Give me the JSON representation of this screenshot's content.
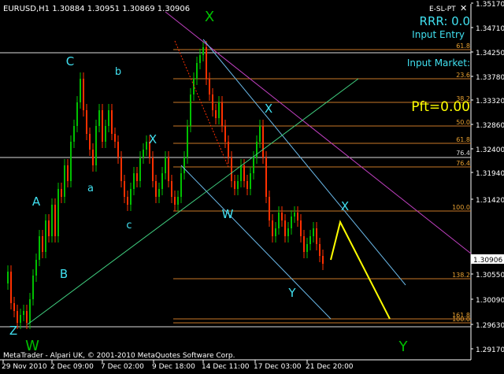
{
  "header": {
    "symbol_info": "EURUSD,H1  1.30884 1.30951 1.30869 1.30906",
    "indicator": "E-SL-PT"
  },
  "footer": {
    "copyright": "MetaTrader - Alpari UK, © 2001-2010 MetaQuotes Software Corp."
  },
  "panel": {
    "rrr": "RRR: 0.0",
    "input_entry": "Input Entry",
    "input_market": "Input Market:",
    "pft": "Pft=0.00"
  },
  "current_price": "1.30906",
  "price_labels": [
    "1.35170",
    "1.34710",
    "1.34250",
    "1.33780",
    "1.33320",
    "1.32860",
    "1.32400",
    "1.31940",
    "1.31420",
    "1.30906",
    "1.30550",
    "1.30090",
    "1.29630",
    "1.29170"
  ],
  "time_labels": [
    "29 Nov 2010",
    "2 Dec 09:00",
    "7 Dec 02:00",
    "9 Dec 18:00",
    "14 Dec 11:00",
    "17 Dec 03:00",
    "21 Dec 20:00"
  ],
  "fib_labels": [
    "61.8",
    "23.6",
    "38.2",
    "50.0",
    "61.8",
    "76.4",
    "76.4",
    "100.0",
    "138.2",
    "161.8",
    "100.0"
  ],
  "wave_labels": [
    "X",
    "C",
    "b",
    "A",
    "a",
    "X",
    "c",
    "B",
    "W",
    "X",
    "X",
    "W",
    "Y",
    "Y",
    "Z",
    "W"
  ],
  "colors": {
    "background": "#000000",
    "bull": "#00c000",
    "bear": "#ff3000",
    "fib": "#c87828",
    "fib_text": "#e8a030",
    "cyan_text": "#40e0f0",
    "green_text": "#00c000",
    "yellow": "#ffff00",
    "magenta": "#c040c0",
    "channel": "#6ab8e8",
    "trend": "#40d080",
    "axis_text": "#ffffff"
  }
}
